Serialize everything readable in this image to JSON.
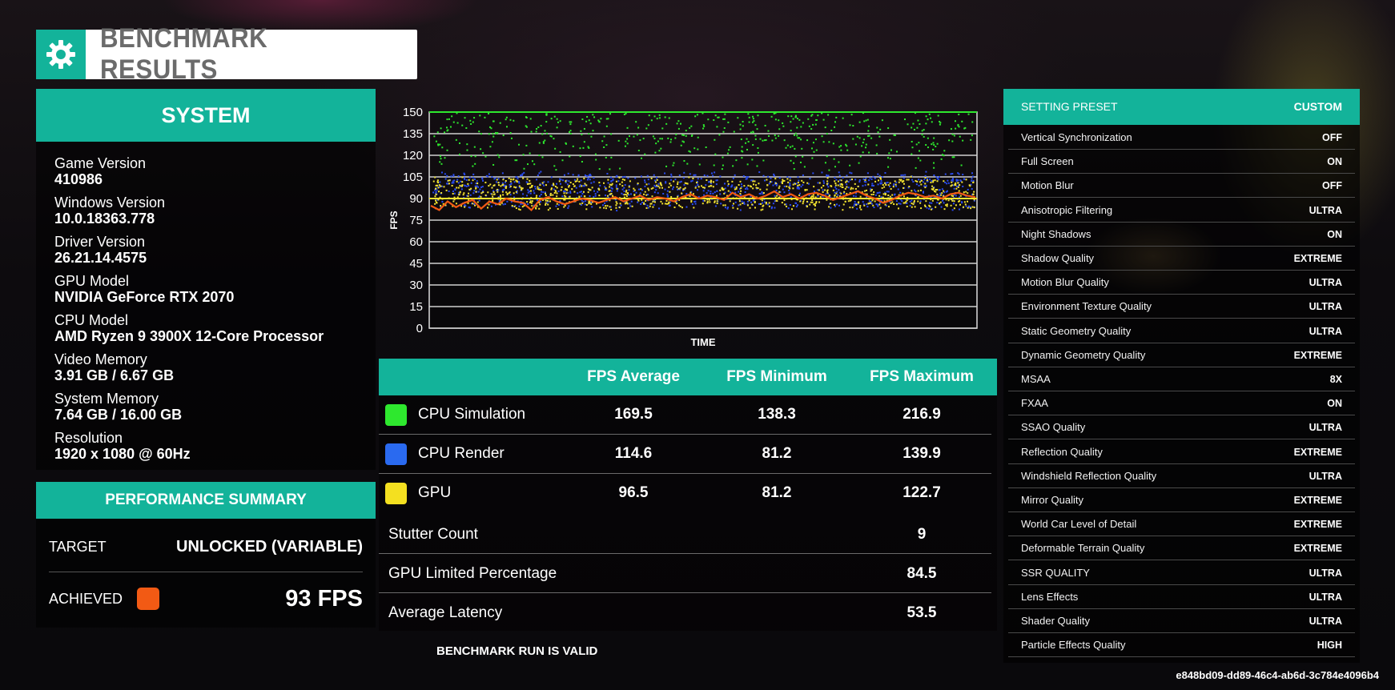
{
  "title": "BENCHMARK RESULTS",
  "icons": {
    "title": "gear-icon"
  },
  "system": {
    "header": "SYSTEM",
    "items": [
      {
        "label": "Game Version",
        "value": "410986"
      },
      {
        "label": "Windows Version",
        "value": "10.0.18363.778"
      },
      {
        "label": "Driver Version",
        "value": "26.21.14.4575"
      },
      {
        "label": "GPU Model",
        "value": "NVIDIA GeForce RTX 2070"
      },
      {
        "label": "CPU Model",
        "value": "AMD Ryzen 9 3900X 12-Core Processor"
      },
      {
        "label": "Video Memory",
        "value": "3.91 GB / 6.67 GB"
      },
      {
        "label": "System Memory",
        "value": "7.64 GB / 16.00 GB"
      },
      {
        "label": "Resolution",
        "value": "1920 x 1080 @ 60Hz"
      }
    ]
  },
  "performance": {
    "header": "PERFORMANCE SUMMARY",
    "target_label": "TARGET",
    "target_value": "UNLOCKED (VARIABLE)",
    "achieved_label": "ACHIEVED",
    "achieved_value": "93 FPS",
    "achieved_color": "#f25a14"
  },
  "chart_data": {
    "type": "line",
    "xlabel": "TIME",
    "ylabel": "FPS",
    "ylim": [
      0,
      150
    ],
    "yticks": [
      "150",
      "135",
      "120",
      "105",
      "90",
      "75",
      "60",
      "45",
      "30",
      "15",
      "0"
    ],
    "grid": true,
    "series": [
      {
        "name": "CPU Simulation",
        "color": "#2ee82e",
        "style": "scatter",
        "band": [
          110,
          150
        ],
        "avg": 169.5
      },
      {
        "name": "CPU Render",
        "color": "#2a4cf0",
        "style": "scatter",
        "band": [
          84,
          108
        ],
        "avg": 114.6
      },
      {
        "name": "GPU",
        "color": "#f4e430",
        "style": "scatter",
        "band": [
          84,
          104
        ],
        "avg": 96.5
      },
      {
        "name": "ACHIEVED",
        "color": "#f25a14",
        "style": "line",
        "values": [
          85,
          82,
          88,
          84,
          87,
          89,
          83,
          88,
          86,
          90,
          88,
          87,
          82,
          89,
          91,
          88,
          86,
          88,
          90,
          89,
          87,
          89,
          91,
          88,
          90,
          92,
          89,
          91,
          90,
          88,
          91,
          93,
          90,
          92,
          91,
          89,
          94,
          91,
          93,
          90,
          92,
          95,
          91,
          93,
          90,
          93,
          94,
          92,
          89,
          91,
          93,
          95,
          92,
          90,
          87,
          89,
          92,
          94,
          93,
          91,
          92,
          90,
          93,
          94,
          92,
          91
        ]
      }
    ],
    "reference_lines": [
      {
        "value": 150,
        "color": "#2ee82e"
      },
      {
        "value": 90,
        "color": "#f4e430"
      }
    ]
  },
  "fps_table": {
    "headers": [
      "FPS Average",
      "FPS Minimum",
      "FPS Maximum"
    ],
    "rows": [
      {
        "name": "CPU Simulation",
        "color": "#2ee82e",
        "avg": "169.5",
        "min": "138.3",
        "max": "216.9"
      },
      {
        "name": "CPU Render",
        "color": "#2a6af0",
        "avg": "114.6",
        "min": "81.2",
        "max": "139.9"
      },
      {
        "name": "GPU",
        "color": "#f4e020",
        "avg": "96.5",
        "min": "81.2",
        "max": "122.7"
      }
    ],
    "stats": [
      {
        "name": "Stutter Count",
        "value": "9"
      },
      {
        "name": "GPU Limited Percentage",
        "value": "84.5"
      },
      {
        "name": "Average Latency",
        "value": "53.5"
      }
    ]
  },
  "valid_text": "BENCHMARK RUN IS VALID",
  "settings": {
    "header_label": "SETTING PRESET",
    "header_value": "CUSTOM",
    "items": [
      {
        "k": "Vertical Synchronization",
        "v": "OFF"
      },
      {
        "k": "Full Screen",
        "v": "ON"
      },
      {
        "k": "Motion Blur",
        "v": "OFF"
      },
      {
        "k": "Anisotropic Filtering",
        "v": "ULTRA"
      },
      {
        "k": "Night Shadows",
        "v": "ON"
      },
      {
        "k": "Shadow Quality",
        "v": "EXTREME"
      },
      {
        "k": "Motion Blur Quality",
        "v": "ULTRA"
      },
      {
        "k": "Environment Texture Quality",
        "v": "ULTRA"
      },
      {
        "k": "Static Geometry Quality",
        "v": "ULTRA"
      },
      {
        "k": "Dynamic Geometry Quality",
        "v": "EXTREME"
      },
      {
        "k": "MSAA",
        "v": "8X"
      },
      {
        "k": "FXAA",
        "v": "ON"
      },
      {
        "k": "SSAO Quality",
        "v": "ULTRA"
      },
      {
        "k": "Reflection Quality",
        "v": "EXTREME"
      },
      {
        "k": "Windshield Reflection Quality",
        "v": "ULTRA"
      },
      {
        "k": "Mirror Quality",
        "v": "EXTREME"
      },
      {
        "k": "World Car Level of Detail",
        "v": "EXTREME"
      },
      {
        "k": "Deformable Terrain Quality",
        "v": "EXTREME"
      },
      {
        "k": "SSR QUALITY",
        "v": "ULTRA"
      },
      {
        "k": "Lens Effects",
        "v": "ULTRA"
      },
      {
        "k": "Shader Quality",
        "v": "ULTRA"
      },
      {
        "k": "Particle Effects Quality",
        "v": "HIGH"
      }
    ]
  },
  "uuid": "e848bd09-dd89-46c4-ab6d-3c784e4096b4"
}
